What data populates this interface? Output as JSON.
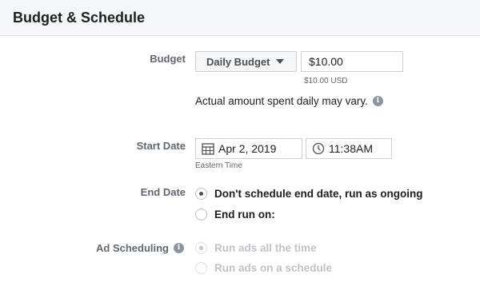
{
  "header": {
    "title": "Budget & Schedule"
  },
  "budget": {
    "label": "Budget",
    "type_selected": "Daily Budget",
    "amount_value": "$10.00",
    "amount_hint": "$10.00 USD",
    "note": "Actual amount spent daily may vary."
  },
  "start": {
    "label": "Start Date",
    "date_value": "Apr 2, 2019",
    "time_value": "11:38AM",
    "timezone": "Eastern Time"
  },
  "end": {
    "label": "End Date",
    "options": [
      {
        "label": "Don't schedule end date, run as ongoing",
        "checked": true
      },
      {
        "label": "End run on:",
        "checked": false
      }
    ]
  },
  "scheduling": {
    "label": "Ad Scheduling",
    "options": [
      {
        "label": "Run ads all the time",
        "checked": true,
        "disabled": true
      },
      {
        "label": "Run ads on a schedule",
        "checked": false,
        "disabled": true
      }
    ]
  },
  "colors": {
    "header_bg": "#f5f6f7",
    "text": "#1c1e21",
    "muted": "#606770",
    "disabled": "#bec3c9"
  },
  "icons": {
    "info": "info-icon",
    "calendar": "calendar-icon",
    "clock": "clock-icon",
    "caret": "caret-down-icon"
  }
}
